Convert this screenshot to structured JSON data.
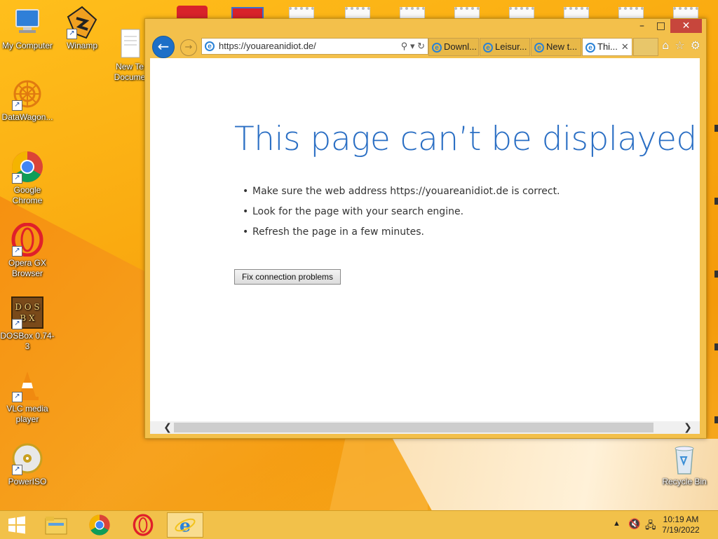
{
  "desktop": {
    "icons": [
      {
        "label": "My Computer"
      },
      {
        "label": "Winamp"
      },
      {
        "label": "New Te\nDocume"
      },
      {
        "label": "DataWagon..."
      },
      {
        "label": "Google Chrome"
      },
      {
        "label": "Opera GX Browser"
      },
      {
        "label": "DOSBox 0.74-3"
      },
      {
        "label": "VLC media player"
      },
      {
        "label": "PowerISO"
      },
      {
        "label": "Recycle Bin"
      }
    ]
  },
  "browser": {
    "address": {
      "url": "https://youareanidiot.de/"
    },
    "tabs": [
      {
        "label": "Downl..."
      },
      {
        "label": "Leisur..."
      },
      {
        "label": "New t..."
      },
      {
        "label": "Thi..."
      }
    ],
    "error": {
      "title": "This page can’t be displayed",
      "tips": [
        "Make sure the web address https://youareanidiot.de is correct.",
        "Look for the page with your search engine.",
        "Refresh the page in a few minutes."
      ],
      "fix_button": "Fix connection problems"
    }
  },
  "taskbar": {
    "time": "10:19 AM",
    "date": "7/19/2022"
  },
  "colors": {
    "accent": "#2b6fc4",
    "window_frame": "#f3c04b",
    "close_button": "#c7463c"
  }
}
